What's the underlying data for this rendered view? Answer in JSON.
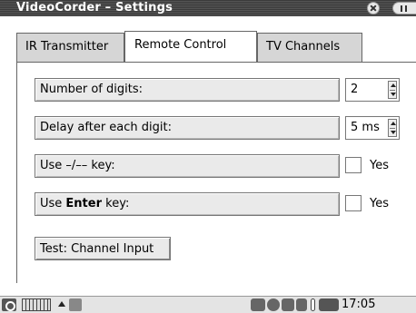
{
  "window": {
    "title": "VideoCorder – Settings"
  },
  "tabs": [
    {
      "label": "IR Transmitter",
      "active": false
    },
    {
      "label": "Remote Control",
      "active": true
    },
    {
      "label": "TV Channels",
      "active": false
    }
  ],
  "settings": {
    "number_of_digits": {
      "label": "Number of digits:",
      "value": "2"
    },
    "delay_after_digit": {
      "label": "Delay after each digit:",
      "value": "5 ms"
    },
    "use_dash_key": {
      "label": "Use –/–– key:",
      "checked": false,
      "option_label": "Yes"
    },
    "use_enter_key": {
      "label_prefix": "Use ",
      "label_bold": "Enter",
      "label_suffix": " key:",
      "checked": false,
      "option_label": "Yes"
    }
  },
  "buttons": {
    "test_label": "Test: Channel Input"
  },
  "taskbar": {
    "clock": "17:05",
    "icons": [
      "start-menu-icon",
      "keyboard-icon",
      "show-more-icon",
      "app-icon",
      "network-icon",
      "globe-icon",
      "chat-icon",
      "clipboard-icon",
      "battery-icon",
      "volume-icon"
    ]
  }
}
